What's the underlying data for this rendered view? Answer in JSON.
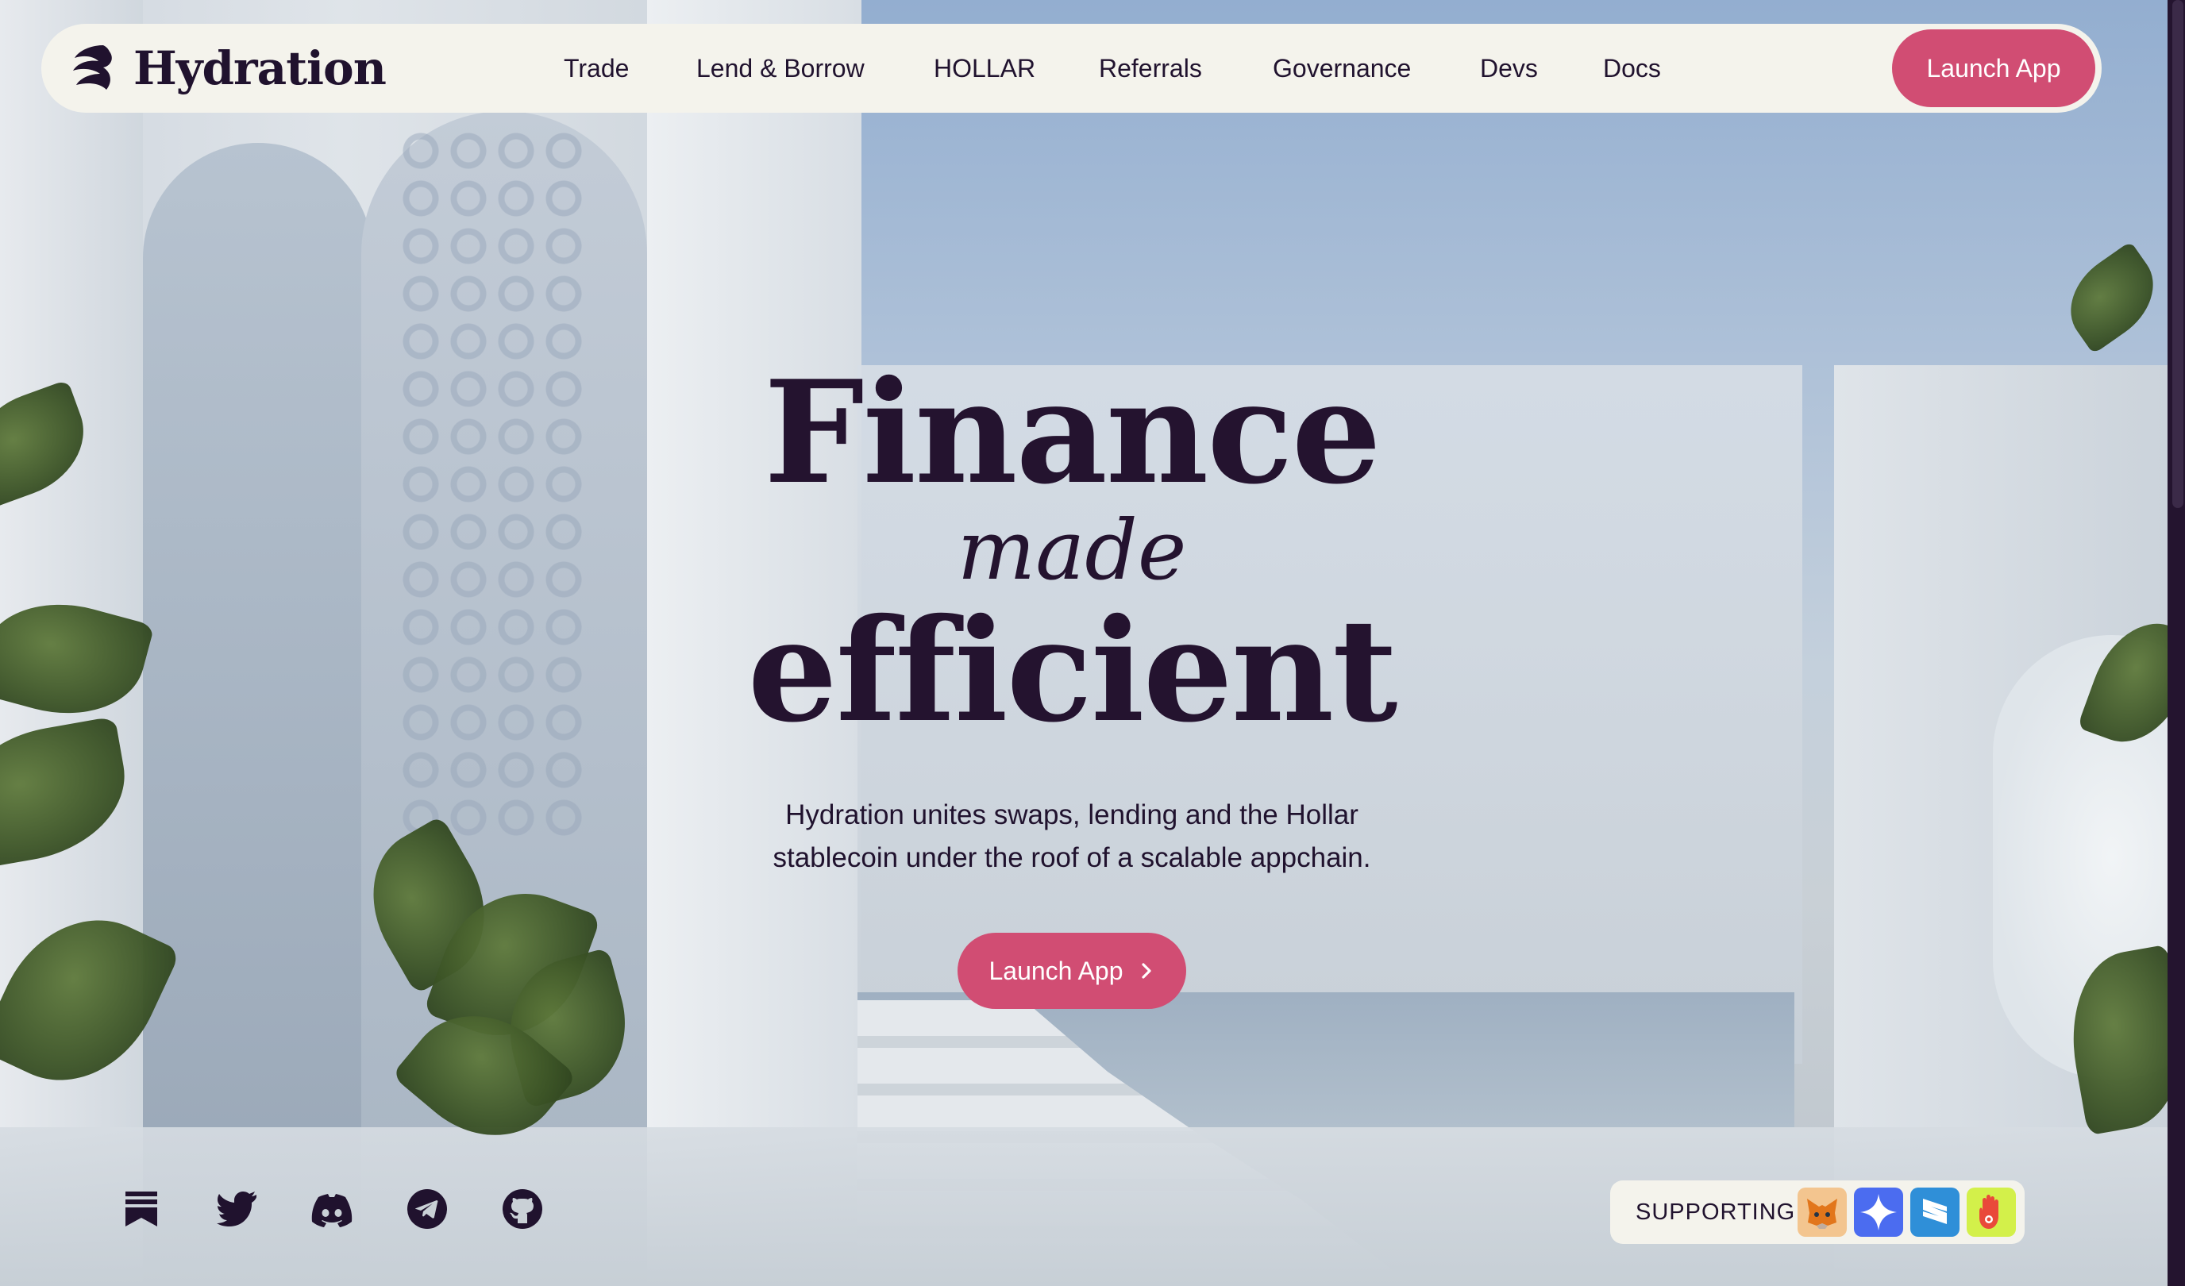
{
  "brand": {
    "name": "Hydration"
  },
  "nav": {
    "links": [
      {
        "label": "Trade"
      },
      {
        "label": "Lend & Borrow"
      },
      {
        "label": "HOLLAR"
      },
      {
        "label": "Referrals"
      },
      {
        "label": "Governance"
      },
      {
        "label": "Devs"
      },
      {
        "label": "Docs"
      }
    ],
    "cta_label": "Launch App"
  },
  "hero": {
    "line1": "Finance",
    "line2": "made",
    "line3": "efficient",
    "description_line1": "Hydration unites swaps, lending and the Hollar",
    "description_line2": "stablecoin under the roof of a scalable appchain.",
    "cta_label": "Launch App"
  },
  "socials": [
    {
      "icon": "substack-icon"
    },
    {
      "icon": "twitter-icon"
    },
    {
      "icon": "discord-icon"
    },
    {
      "icon": "telegram-icon"
    },
    {
      "icon": "github-icon"
    }
  ],
  "supporting": {
    "label": "SUPPORTING",
    "wallets": [
      {
        "icon": "metamask-icon",
        "color": "#f3c58f"
      },
      {
        "icon": "sparkle-wallet-icon",
        "color": "#4b6cf0"
      },
      {
        "icon": "subwallet-icon",
        "color": "#2f8fd8"
      },
      {
        "icon": "talisman-icon",
        "color": "#d3f04a"
      }
    ]
  },
  "colors": {
    "accent": "#d14d73",
    "ink": "#20122e",
    "nav_bg": "#f4f3ec"
  }
}
